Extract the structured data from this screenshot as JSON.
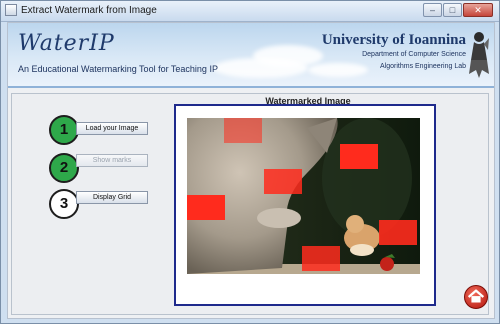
{
  "window": {
    "title": "Extract Watermark from Image",
    "minimize_glyph": "–",
    "maximize_glyph": "□",
    "close_glyph": "✕"
  },
  "banner": {
    "app_name": "WaterIP",
    "subtitle": "An Educational Watermarking Tool for Teaching IP",
    "university": "University of Ioannina",
    "department": "Department of Computer Science",
    "lab": "Algorithms Engineering Lab"
  },
  "steps": [
    {
      "number": "1",
      "label": "Load your Image",
      "enabled": true
    },
    {
      "number": "2",
      "label": "Show marks",
      "enabled": false
    },
    {
      "number": "3",
      "label": "Display Grid",
      "enabled": true
    }
  ],
  "image_panel": {
    "title": "Watermarked Image"
  },
  "icons": {
    "app": "window-app-icon",
    "home": "home-icon",
    "logo": "university-logo"
  },
  "colors": {
    "step_green": "#2ea84a",
    "frame_blue": "#1e2a8c",
    "mark_red": "#ff2b1d",
    "home_red": "#c9221a"
  }
}
